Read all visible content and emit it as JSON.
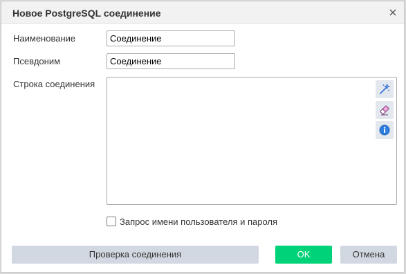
{
  "dialog": {
    "title": "Новое PostgreSQL соединение"
  },
  "form": {
    "name_label": "Наименование",
    "name_value": "Соединение",
    "alias_label": "Псевдоним",
    "alias_value": "Соединение",
    "connection_string_label": "Строка соединения",
    "connection_string_value": "",
    "ask_credentials_label": "Запрос имени пользователя и пароля",
    "ask_credentials_checked": false
  },
  "side_tools": [
    {
      "icon": "magic-wand-icon"
    },
    {
      "icon": "eraser-icon"
    },
    {
      "icon": "info-icon"
    }
  ],
  "buttons": {
    "test_label": "Проверка соединения",
    "ok_label": "OK",
    "cancel_label": "Отмена"
  },
  "colors": {
    "ok_button": "#00d27a",
    "secondary_button": "#d2d8e1",
    "title_bar": "#f2f2f2"
  }
}
